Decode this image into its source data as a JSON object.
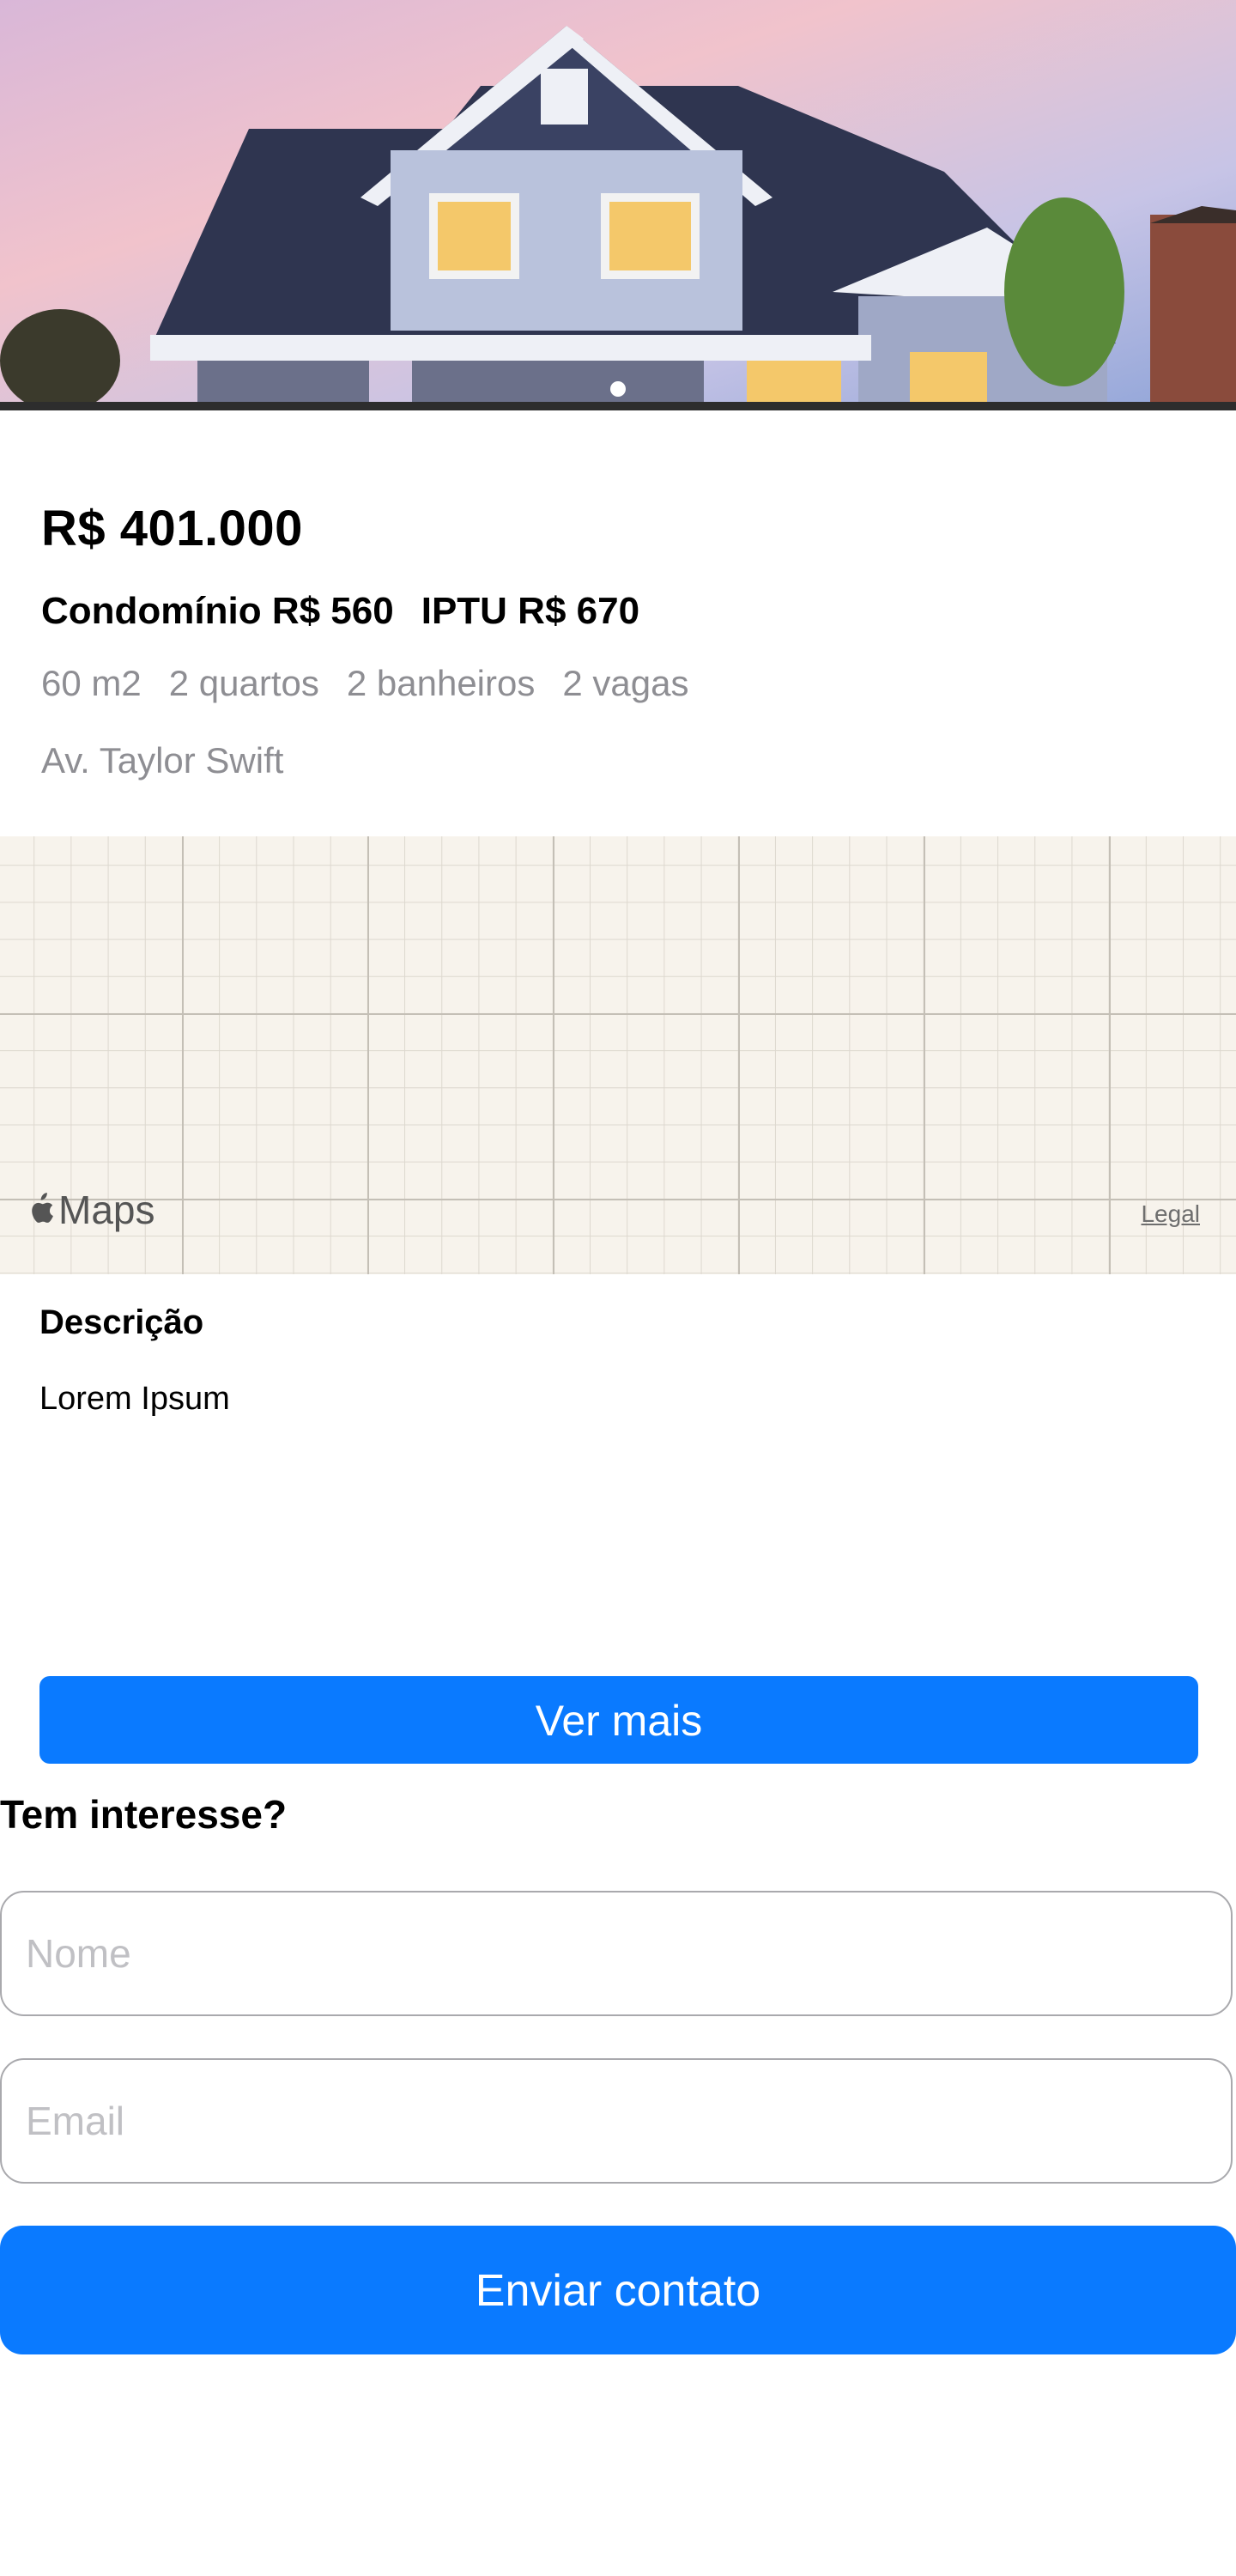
{
  "listing": {
    "price": "R$ 401.000",
    "condominio": "Condomínio R$ 560",
    "iptu": "IPTU R$ 670",
    "features": [
      "60 m2",
      "2 quartos",
      "2 banheiros",
      "2 vagas"
    ],
    "address": "Av. Taylor Swift"
  },
  "gallery": {
    "image": "house-photo",
    "page_count": 1,
    "current_page": 1
  },
  "map": {
    "brand": "Maps",
    "legal_label": "Legal"
  },
  "description": {
    "title": "Descrição",
    "text": "Lorem Ipsum",
    "more_button": "Ver mais"
  },
  "contact": {
    "title": "Tem interesse?",
    "name_placeholder": "Nome",
    "email_placeholder": "Email",
    "submit_label": "Enviar contato"
  },
  "colors": {
    "accent": "#0a7aff",
    "secondary_text": "#8e8e93",
    "map_background": "#f7f3ec"
  }
}
